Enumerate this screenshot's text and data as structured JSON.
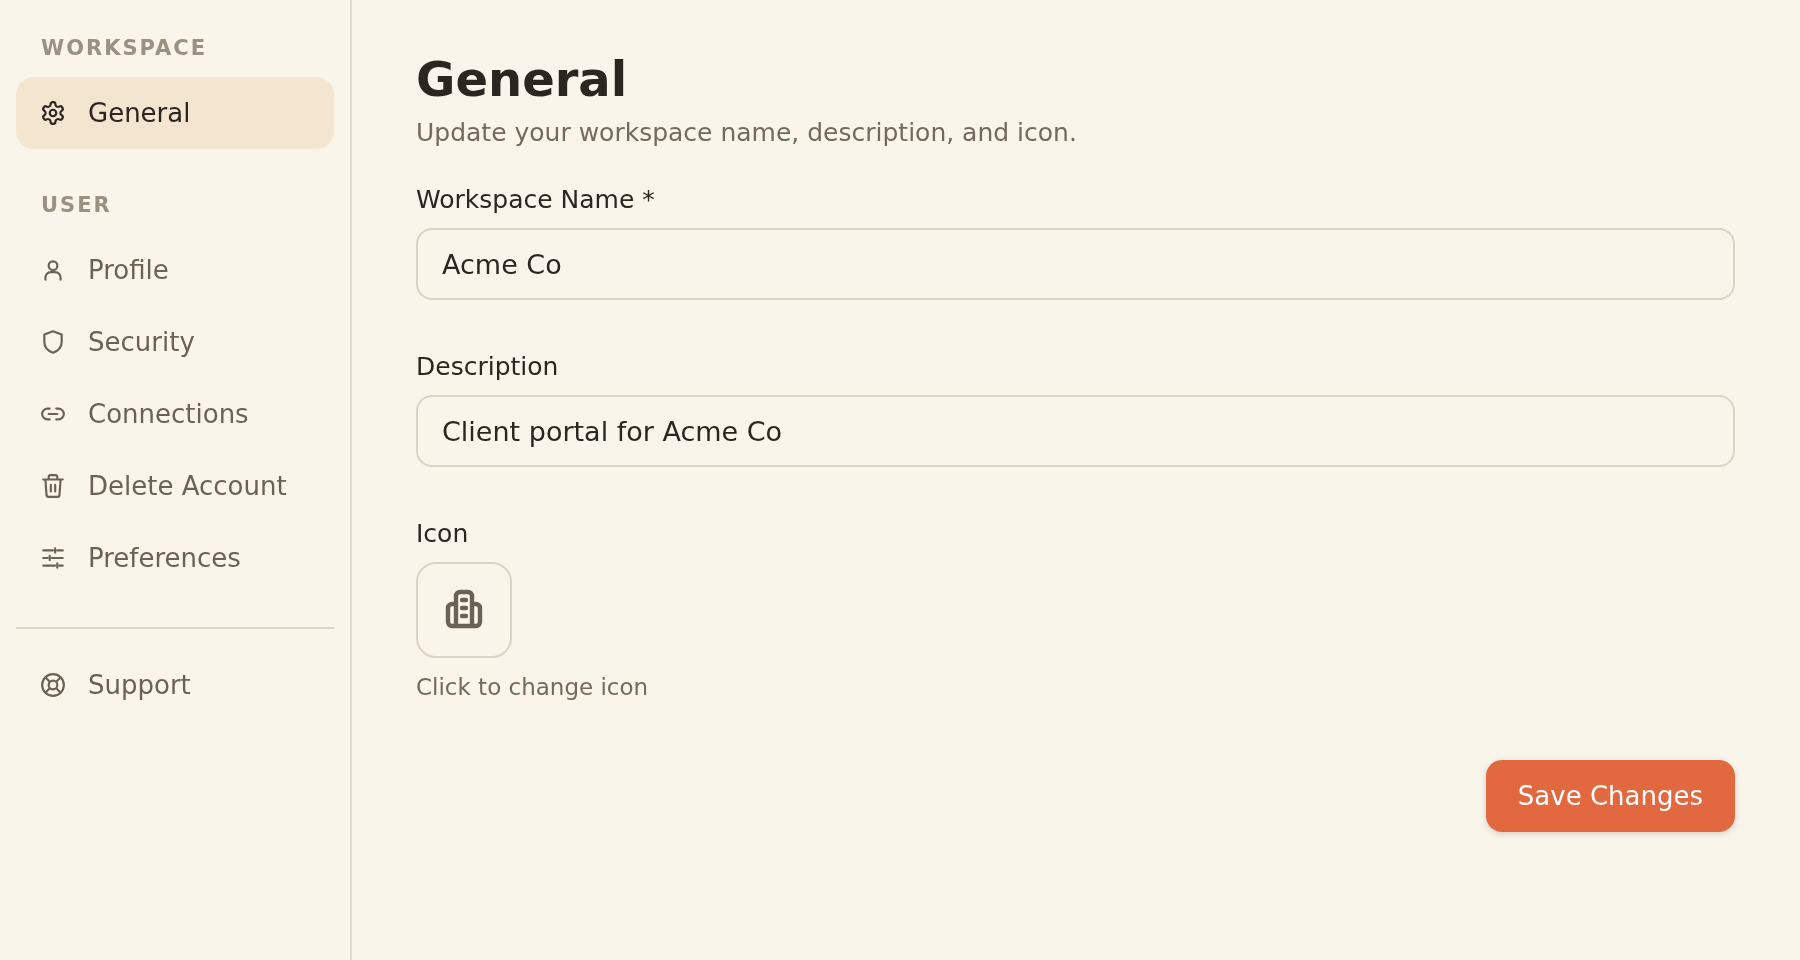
{
  "sidebar": {
    "sections": [
      {
        "heading": "WORKSPACE",
        "items": [
          {
            "label": "General",
            "selected": true
          }
        ]
      },
      {
        "heading": "USER",
        "items": [
          {
            "label": "Profile",
            "selected": false
          },
          {
            "label": "Security",
            "selected": false
          },
          {
            "label": "Connections",
            "selected": false
          },
          {
            "label": "Delete Account",
            "selected": false
          },
          {
            "label": "Preferences",
            "selected": false
          }
        ]
      }
    ],
    "footer_items": [
      {
        "label": "Support",
        "selected": false
      }
    ]
  },
  "main": {
    "title": "General",
    "subtitle": "Update your workspace name, description, and icon.",
    "fields": [
      {
        "label": "Workspace Name *",
        "value": "Acme Co"
      },
      {
        "label": "Description",
        "value": "Client portal for Acme Co"
      }
    ],
    "icon_picker": {
      "label": "Icon",
      "hint": "Click to change icon"
    },
    "save_button": "Save Changes"
  }
}
